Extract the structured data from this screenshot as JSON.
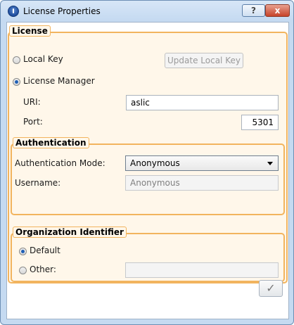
{
  "window": {
    "title": "License Properties",
    "help_glyph": "?",
    "close_glyph": "x"
  },
  "license": {
    "title": "License",
    "local_key_label": "Local Key",
    "update_button_label": "Update Local Key",
    "license_manager_label": "License Manager",
    "uri_label": "URI:",
    "uri_value": "aslic",
    "port_label": "Port:",
    "port_value": "5301",
    "selected": "License Manager"
  },
  "authentication": {
    "title": "Authentication",
    "mode_label": "Authentication Mode:",
    "mode_value": "Anonymous",
    "username_label": "Username:",
    "username_value": "Anonymous"
  },
  "organization": {
    "title": "Organization Identifier",
    "default_label": "Default",
    "other_label": "Other:",
    "other_value": "",
    "selected": "Default"
  },
  "footer": {
    "ok_glyph": "✓"
  },
  "colors": {
    "group_border": "#f2b45e",
    "group_fill": "#fff7ea",
    "title_gradient": "#c5daf1"
  }
}
